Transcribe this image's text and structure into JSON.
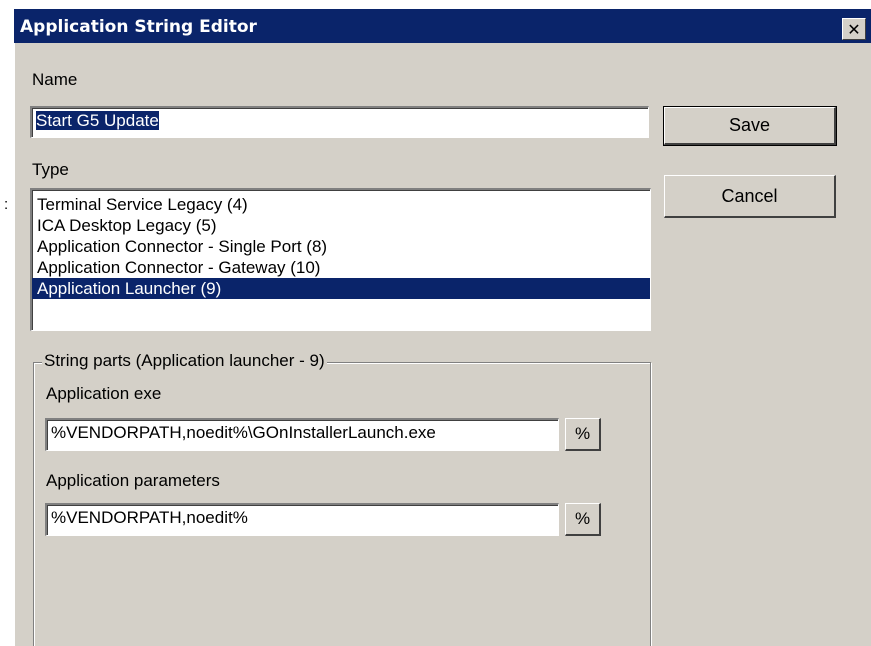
{
  "window": {
    "title": "Application String Editor",
    "close_glyph": "✕"
  },
  "stray_text": ":",
  "name_field": {
    "label": "Name",
    "value": "Start G5 Update"
  },
  "type_field": {
    "label": "Type",
    "items": [
      "Terminal Service Legacy (4)",
      "ICA Desktop Legacy (5)",
      "Application Connector - Single Port (8)",
      "Application Connector - Gateway (10)",
      "Application Launcher (9)"
    ],
    "selected": "Application Launcher (9)"
  },
  "buttons": {
    "save": "Save",
    "cancel": "Cancel"
  },
  "string_parts": {
    "legend": "String parts (Application launcher - 9)",
    "exe_label": "Application exe",
    "exe_value": "%VENDORPATH,noedit%\\GOnInstallerLaunch.exe",
    "params_label": "Application parameters",
    "params_value": "%VENDORPATH,noedit%",
    "insert_var_label": "%"
  },
  "colors": {
    "titlebar": "#0a246a",
    "dialog_bg": "#d4d0c8",
    "selection": "#0a246a"
  },
  "icons": {
    "close": "close-icon"
  }
}
